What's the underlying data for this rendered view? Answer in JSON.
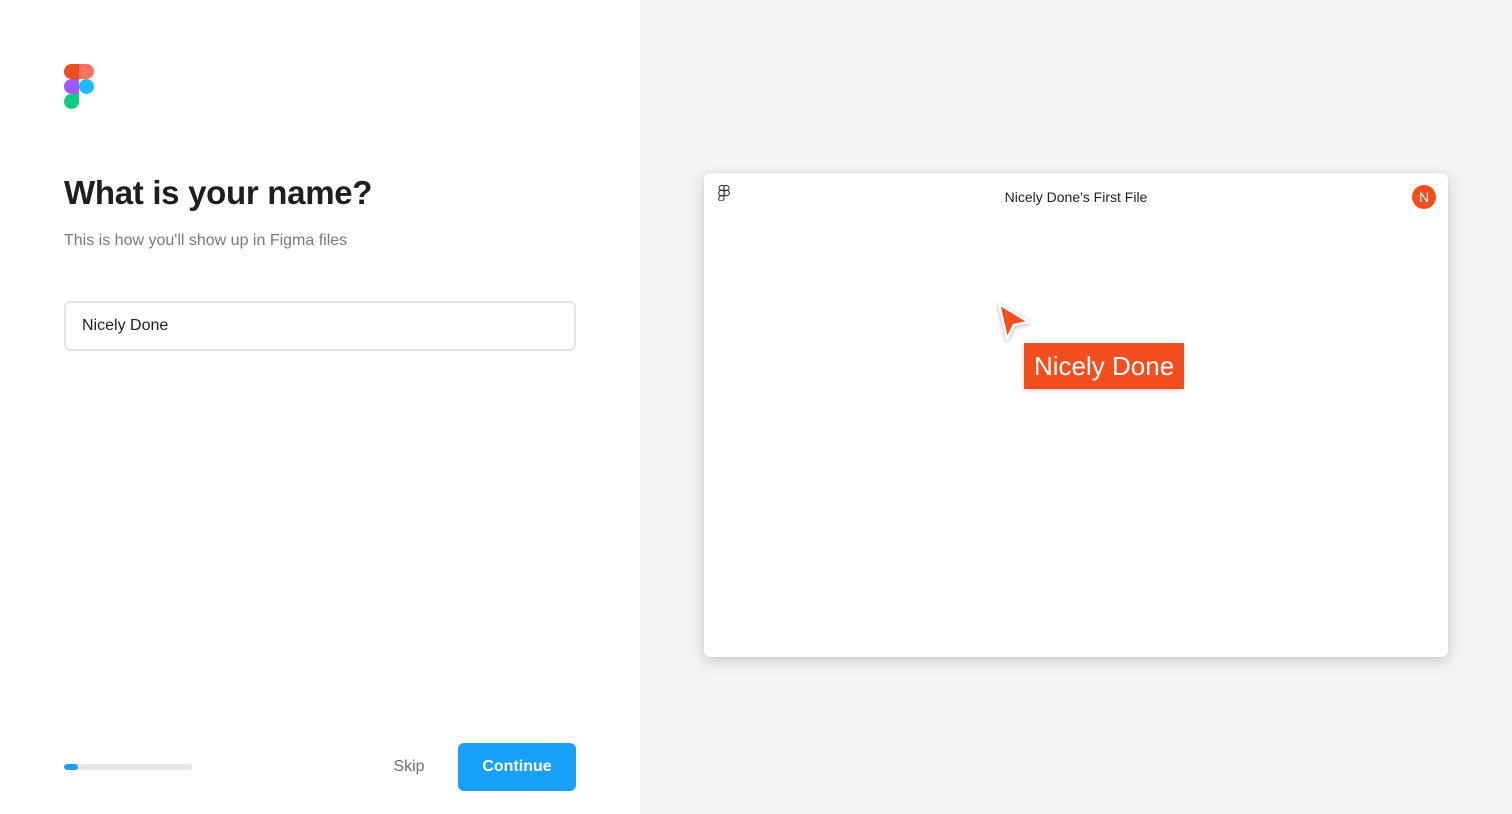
{
  "onboarding": {
    "title": "What is your name?",
    "subtitle": "This is how you'll show up in Figma files",
    "name_input": {
      "value": "Nicely Done",
      "placeholder": ""
    },
    "progress": 0.11,
    "skip_label": "Skip",
    "continue_label": "Continue"
  },
  "preview": {
    "file_title": "Nicely Done's First File",
    "avatar_initial": "N",
    "cursor_label": "Nicely Done"
  },
  "icons": {
    "logo": "figma-logo-icon",
    "preview_logo": "figma-logo-icon",
    "cursor": "cursor-arrow-icon"
  },
  "colors": {
    "accent": "#18a0fb",
    "user_color": "#f24e1e",
    "figma_red": "#f24e1e",
    "figma_orange": "#ff7262",
    "figma_purple": "#a259ff",
    "figma_blue": "#1abcfe",
    "figma_green": "#0acf83"
  }
}
